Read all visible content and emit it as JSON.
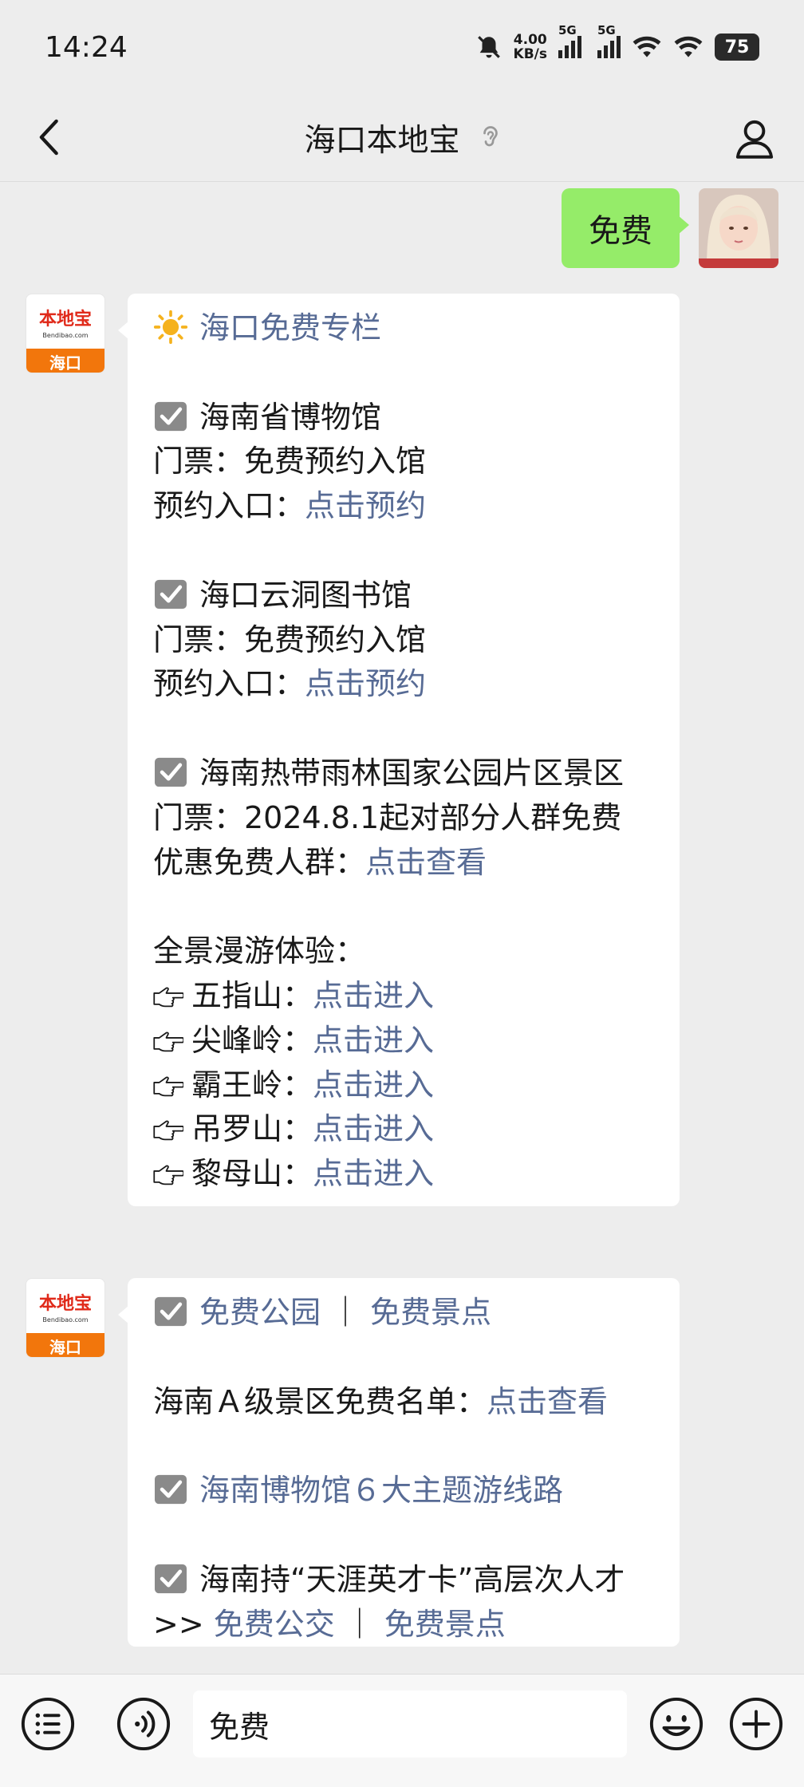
{
  "status": {
    "time": "14:24",
    "speed_value": "4.00",
    "speed_unit": "KB/s",
    "net1": "5G",
    "net2": "5G",
    "battery": "75"
  },
  "header": {
    "title": "海口本地宝"
  },
  "user": {
    "message": "免费"
  },
  "bot_avatar": {
    "logo": "本地宝",
    "domain": "Bendibao.com",
    "city": "海口"
  },
  "msg1": {
    "title": "海口免费专栏",
    "s1": {
      "name": "海南省博物馆",
      "ticket": "门票：免费预约入馆",
      "entry_label": "预约入口：",
      "entry_link": "点击预约"
    },
    "s2": {
      "name": "海口云洞图书馆",
      "ticket": "门票：免费预约入馆",
      "entry_label": "预约入口：",
      "entry_link": "点击预约"
    },
    "s3": {
      "name": "海南热带雨林国家公园片区景区",
      "ticket": "门票：2024.8.1起对部分人群免费",
      "entry_label": "优惠免费人群：",
      "entry_link": "点击查看"
    },
    "tour_title": "全景漫游体验：",
    "tours": [
      {
        "name": "五指山：",
        "link": "点击进入"
      },
      {
        "name": "尖峰岭：",
        "link": "点击进入"
      },
      {
        "name": "霸王岭：",
        "link": "点击进入"
      },
      {
        "name": "吊罗山：",
        "link": "点击进入"
      },
      {
        "name": "黎母山：",
        "link": "点击进入"
      }
    ]
  },
  "msg2": {
    "link_park": "免费公园",
    "sep": "｜",
    "link_spot": "免费景点",
    "list_label": "海南Ａ级景区免费名单：",
    "list_link": "点击查看",
    "routes_link": "海南博物馆６大主题游线路",
    "talent": "海南持“天涯英才卡”高层次人才",
    "more_prefix": ">>",
    "more_park": "免费公交",
    "more_spot": "免费景点"
  },
  "input": {
    "value": "免费"
  },
  "colors": {
    "link": "#576b95",
    "user_bubble": "#95ec69",
    "background": "#ededed",
    "brand_orange": "#f2760c",
    "brand_red": "#e02a1a"
  },
  "icons": [
    "back-chevron-icon",
    "ear-icon",
    "person-icon",
    "sun-icon",
    "checkbox-icon",
    "pointing-hand-icon",
    "list-menu-icon",
    "voice-icon",
    "emoji-icon",
    "plus-icon"
  ]
}
